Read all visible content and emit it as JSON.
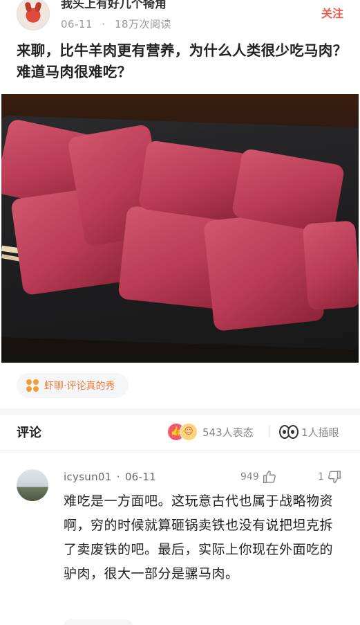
{
  "post": {
    "author": "我头上有好几个犄角",
    "date": "06-11",
    "views": "18万次阅读",
    "meta_separator": "·",
    "follow_label": "关注",
    "title": "来聊，比牛羊肉更有营养，为什么人类很少吃马肉？难道马肉很难吃？"
  },
  "tag": {
    "icon": "grid-dots-icon",
    "label": "虾聊·评论真的秀"
  },
  "comments_section": {
    "title": "评论",
    "reactions_count": "543人表态",
    "blink_count": "1人插眼",
    "reaction_icons": [
      "like-reaction-icon",
      "laugh-reaction-icon"
    ]
  },
  "comment": {
    "username": "icysun01",
    "date": "06-11",
    "separator": "·",
    "likes": "949",
    "dislikes": "1",
    "text": "难吃是一方面吧。这玩意古代也属于战略物资啊，穷的时候就算砸锅卖铁也没有说把坦克拆了卖废铁的吧。最后，实际上你现在外面吃的驴肉，很大一部分是骡马肉。"
  },
  "colors": {
    "accent": "#f05a4f",
    "tag_text": "#f07a3a",
    "muted": "#999999"
  }
}
